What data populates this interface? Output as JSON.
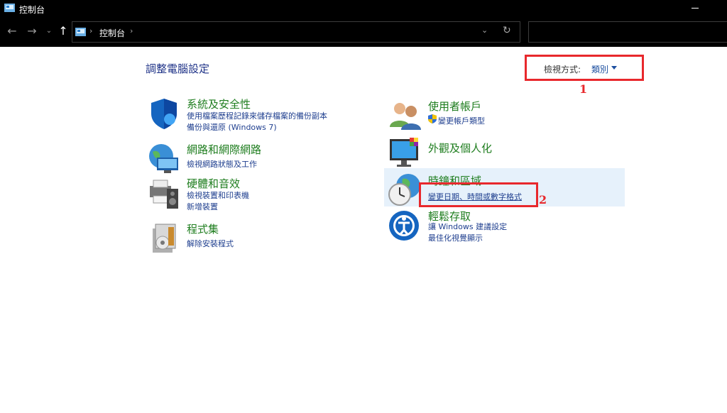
{
  "window": {
    "title": "控制台"
  },
  "address": {
    "crumb": "控制台",
    "separator": "›"
  },
  "nav_icons": [
    "back-arrow-icon",
    "forward-arrow-icon",
    "recent-locations-chevron-icon",
    "up-arrow-icon"
  ],
  "page": {
    "title": "調整電腦設定"
  },
  "view_by": {
    "label": "檢視方式:",
    "value": "類別"
  },
  "categories": {
    "security": {
      "heading": "系統及安全性",
      "links": [
        "使用檔案歷程記錄來儲存檔案的備份副本",
        "備份與還原 (Windows 7)"
      ]
    },
    "network": {
      "heading": "網路和網際網路",
      "links": [
        "檢視網路狀態及工作"
      ]
    },
    "hardware": {
      "heading": "硬體和音效",
      "links": [
        "檢視裝置和印表機",
        "新增裝置"
      ]
    },
    "programs": {
      "heading": "程式集",
      "links": [
        "解除安裝程式"
      ]
    },
    "accounts": {
      "heading": "使用者帳戶",
      "links": [
        "變更帳戶類型"
      ]
    },
    "appearance": {
      "heading": "外觀及個人化",
      "links": []
    },
    "clock": {
      "heading": "時鐘和區域",
      "links": [
        "變更日期、時間或數字格式"
      ]
    },
    "ease": {
      "heading": "輕鬆存取",
      "links": [
        "讓 Windows 建議設定",
        "最佳化視覺顯示"
      ]
    }
  },
  "annotations": {
    "marker1": "1",
    "marker2": "2"
  },
  "colors": {
    "annotation_red": "#e8282c",
    "heading_green": "#1e7d1e",
    "link_blue": "#1f3f8f"
  }
}
